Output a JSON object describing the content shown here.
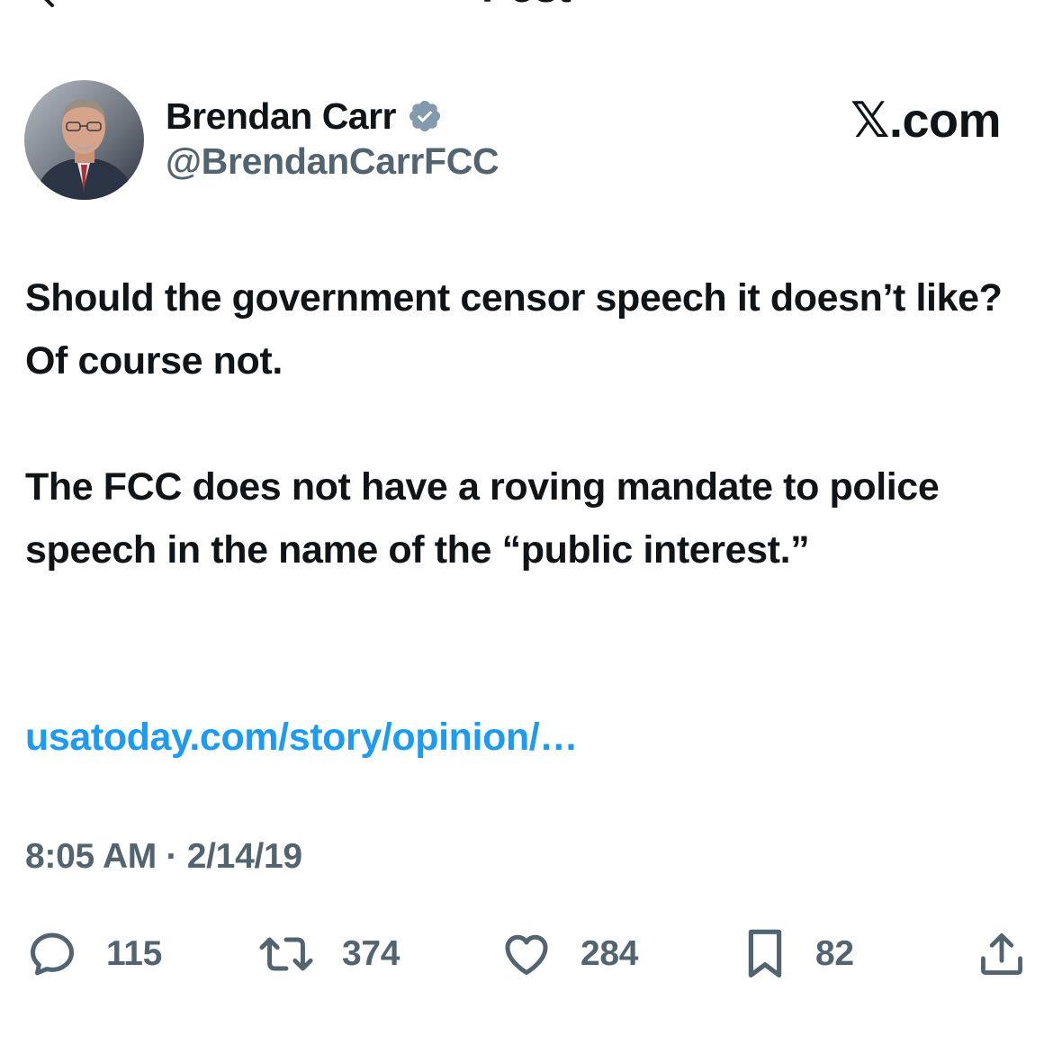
{
  "header": {
    "title": "Post"
  },
  "author": {
    "name": "Brendan Carr",
    "handle": "@BrendanCarrFCC",
    "verified": true
  },
  "watermark": "𝕏.com",
  "post": {
    "paragraphs": [
      "Should the government censor speech it doesn’t like?  Of course not.",
      "The FCC does not have a roving mandate to police speech in the name of the “public interest.”"
    ],
    "link": "usatoday.com/story/opinion/…",
    "timestamp": "8:05 AM · 2/14/19"
  },
  "actions": {
    "replies": "115",
    "reposts": "374",
    "likes": "284",
    "bookmarks": "82"
  },
  "colors": {
    "text": "#0f1419",
    "muted": "#536471",
    "link": "#1d9bf0",
    "verified_badge": "#829aab"
  },
  "icons": [
    "back-arrow-icon",
    "verified-badge-icon",
    "reply-icon",
    "repost-icon",
    "like-icon",
    "bookmark-icon",
    "share-icon"
  ]
}
